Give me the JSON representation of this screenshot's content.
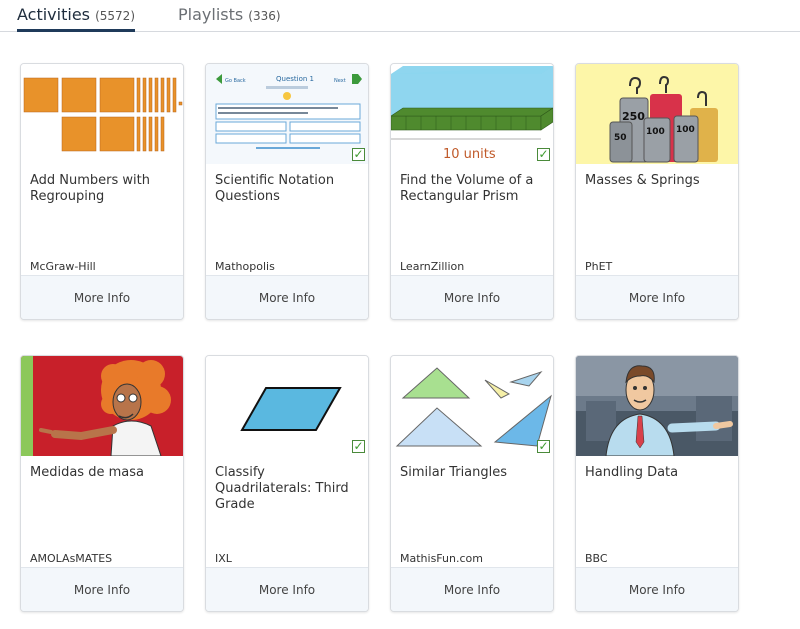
{
  "tabs": {
    "activities": {
      "label": "Activities",
      "count": "(5572)"
    },
    "playlists": {
      "label": "Playlists",
      "count": "(336)"
    }
  },
  "more_label": "More Info",
  "cards": [
    {
      "title": "Add Numbers with Regrouping",
      "publisher": "McGraw-Hill",
      "thumb": "base-ten-blocks",
      "checked": false
    },
    {
      "title": "Scientific Notation Questions",
      "publisher": "Mathopolis",
      "thumb": "quiz-screenshot",
      "checked": true,
      "thumb_text": {
        "question": "Question 1",
        "prev": "Go Back",
        "next": "Next"
      }
    },
    {
      "title": "Find the Volume of a Rectangular Prism",
      "publisher": "LearnZillion",
      "thumb": "prism-blocks",
      "checked": true,
      "thumb_text": {
        "caption": "10 units"
      }
    },
    {
      "title": "Masses & Springs",
      "publisher": "PhET",
      "thumb": "weights",
      "checked": false,
      "thumb_text": {
        "w1": "250",
        "w2": "50",
        "w3": "100",
        "w4": "100"
      }
    },
    {
      "title": "Medidas de masa",
      "publisher": "AMOLAsMATES",
      "thumb": "cartoon-scientist",
      "checked": false
    },
    {
      "title": "Classify Quadrilaterals: Third Grade",
      "publisher": "IXL",
      "thumb": "parallelogram",
      "checked": true
    },
    {
      "title": "Similar Triangles",
      "publisher": "MathisFun.com",
      "thumb": "triangles",
      "checked": true
    },
    {
      "title": "Handling Data",
      "publisher": "BBC",
      "thumb": "cartoon-presenter",
      "checked": false
    }
  ],
  "colors": {
    "tab_active": "#1f3a5a",
    "more_bg": "#f3f7fb",
    "check": "#3d9a2e"
  }
}
